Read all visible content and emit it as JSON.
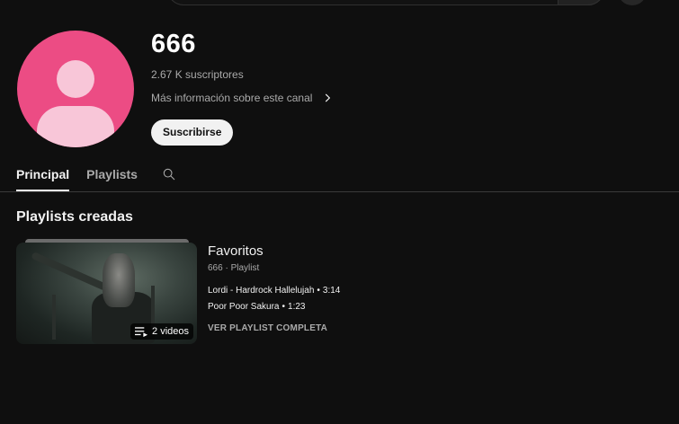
{
  "channel": {
    "name": "666",
    "subscribers": "2.67 K suscriptores",
    "more_info": "Más información sobre este canal",
    "subscribe_label": "Suscribirse",
    "avatar_color": "#ec4c84"
  },
  "tabs": [
    {
      "label": "Principal",
      "active": true
    },
    {
      "label": "Playlists",
      "active": false
    }
  ],
  "section": {
    "title": "Playlists creadas"
  },
  "playlist": {
    "title": "Favoritos",
    "meta": "666 · Playlist",
    "video_count": "2 videos",
    "videos": [
      {
        "title": "Lordi - Hardrock Hallelujah",
        "duration": "3:14"
      },
      {
        "title": "Poor Poor Sakura",
        "duration": "1:23"
      }
    ],
    "view_full": "VER PLAYLIST COMPLETA"
  },
  "icons": {
    "search": "search-icon",
    "chevron": "chevron-right-icon",
    "playlist": "playlist-icon"
  }
}
